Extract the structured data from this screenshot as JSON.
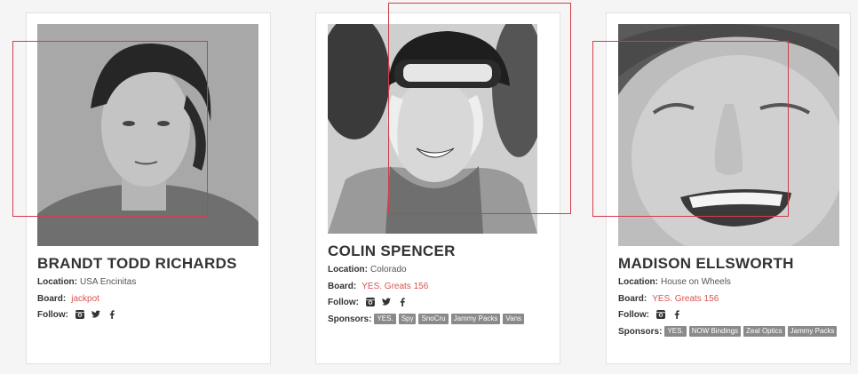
{
  "riders": [
    {
      "name": "BRANDT TODD RICHARDS",
      "location_label": "Location:",
      "location": "USA Encinitas",
      "board_label": "Board:",
      "board": "jackpot",
      "follow_label": "Follow:",
      "social": [
        "instagram-icon",
        "twitter-icon",
        "facebook-icon"
      ],
      "photo_desc": "black-and-white portrait"
    },
    {
      "name": "COLIN SPENCER",
      "location_label": "Location:",
      "location": "Colorado",
      "board_label": "Board:",
      "board": "YES. Greats 156",
      "follow_label": "Follow:",
      "social": [
        "instagram-icon",
        "twitter-icon",
        "facebook-icon"
      ],
      "sponsors_label": "Sponsors:",
      "sponsors": [
        "YES.",
        "Spy",
        "SnoCru",
        "Jammy Packs",
        "Vans"
      ]
    },
    {
      "name": "MADISON ELLSWORTH",
      "location_label": "Location:",
      "location": "House on Wheels",
      "board_label": "Board:",
      "board": "YES. Greats 156",
      "follow_label": "Follow:",
      "social": [
        "instagram-icon",
        "facebook-icon"
      ],
      "sponsors_label": "Sponsors:",
      "sponsors": [
        "YES.",
        "NOW Bindings",
        "Zeal Optics",
        "Jammy Packs"
      ]
    }
  ],
  "colors": {
    "accent": "#d9534f",
    "tag_bg": "#8a8a8a",
    "box": "#d23c4a"
  }
}
